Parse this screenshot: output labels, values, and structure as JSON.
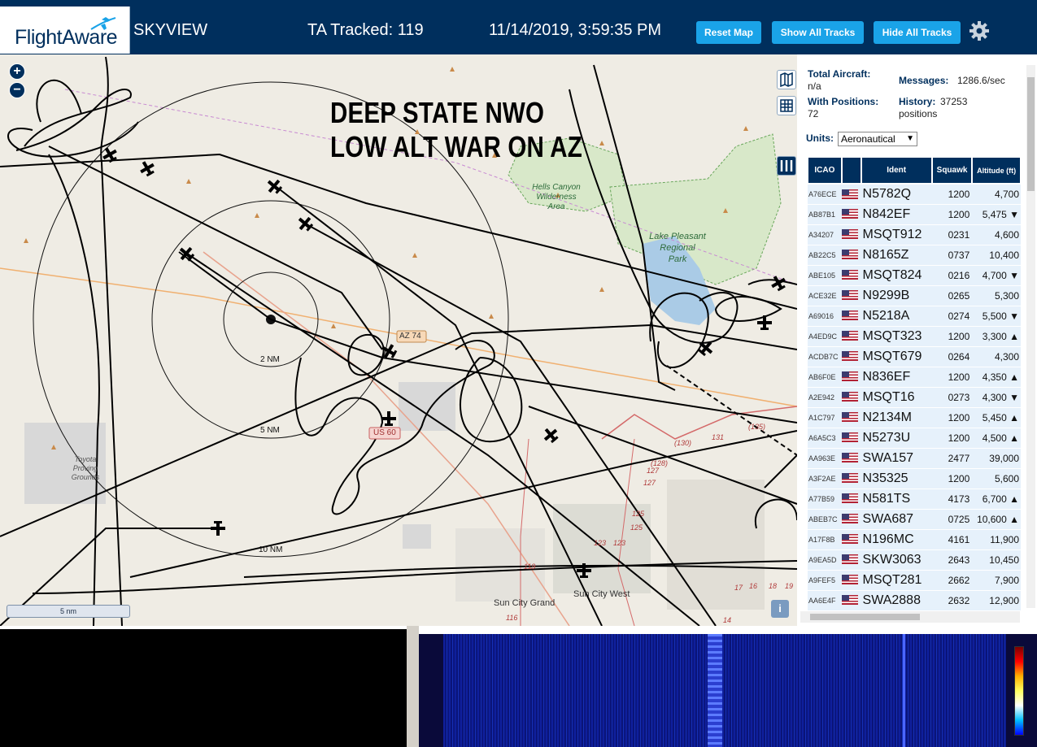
{
  "header": {
    "logo": "FlightAware",
    "app_name": "SKYVIEW",
    "ta_tracked": "TA Tracked: 119",
    "datetime": "11/14/2019, 3:59:35 PM",
    "buttons": {
      "reset_map": "Reset Map",
      "show_all": "Show All Tracks",
      "hide_all": "Hide All Tracks"
    }
  },
  "map": {
    "overlay_line1": "DEEP STATE NWO",
    "overlay_line2": "LOW ALT WAR ON AZ",
    "range_rings": [
      "2 NM",
      "5 NM",
      "10 NM"
    ],
    "road_labels": [
      "AZ 74",
      "US 60"
    ],
    "place_labels": {
      "hells_canyon": [
        "Hells Canyon",
        "Wilderness",
        "Area"
      ],
      "lake_pleasant": [
        "Lake Pleasant",
        "Regional",
        "Park"
      ],
      "toyota": [
        "Toyota",
        "Proving",
        "Grounds"
      ],
      "sun_city_grand": "Sun City Grand",
      "sun_city_west": "Sun City West"
    },
    "route_numbers": [
      "(130)",
      "131",
      "(128)",
      "127",
      "127",
      "125",
      "125",
      "123",
      "123",
      "119",
      "116",
      "14",
      "17",
      "16",
      "18",
      "19",
      "(135)"
    ],
    "scale": "5 nm",
    "zoom_in": "+",
    "zoom_out": "−",
    "info": "i"
  },
  "sidebar": {
    "total_aircraft_label": "Total Aircraft:",
    "total_aircraft_value": "n/a",
    "messages_label": "Messages:",
    "messages_value": "1286.6/sec",
    "positions_label": "With Positions:",
    "positions_value": "72",
    "history_label": "History:",
    "history_value": "37253",
    "history_unit": "positions",
    "units_label": "Units:",
    "units_value": "Aeronautical",
    "columns": [
      "ICAO",
      "Ident",
      "Squawk",
      "Altitude (ft)"
    ],
    "rows": [
      {
        "icao": "A76ECE",
        "ident": "N5782Q",
        "squawk": "1200",
        "alt": "4,700"
      },
      {
        "icao": "AB87B1",
        "ident": "N842EF",
        "squawk": "1200",
        "alt": "5,475 ▼"
      },
      {
        "icao": "A34207",
        "ident": "MSQT912",
        "squawk": "0231",
        "alt": "4,600"
      },
      {
        "icao": "AB22C5",
        "ident": "N8165Z",
        "squawk": "0737",
        "alt": "10,400"
      },
      {
        "icao": "ABE105",
        "ident": "MSQT824",
        "squawk": "0216",
        "alt": "4,700 ▼"
      },
      {
        "icao": "ACE32E",
        "ident": "N9299B",
        "squawk": "0265",
        "alt": "5,300"
      },
      {
        "icao": "A69016",
        "ident": "N5218A",
        "squawk": "0274",
        "alt": "5,500 ▼"
      },
      {
        "icao": "A4ED9C",
        "ident": "MSQT323",
        "squawk": "1200",
        "alt": "3,300 ▲"
      },
      {
        "icao": "ACDB7C",
        "ident": "MSQT679",
        "squawk": "0264",
        "alt": "4,300"
      },
      {
        "icao": "AB6F0E",
        "ident": "N836EF",
        "squawk": "1200",
        "alt": "4,350 ▲"
      },
      {
        "icao": "A2E942",
        "ident": "MSQT16",
        "squawk": "0273",
        "alt": "4,300 ▼"
      },
      {
        "icao": "A1C797",
        "ident": "N2134M",
        "squawk": "1200",
        "alt": "5,450 ▲"
      },
      {
        "icao": "A6A5C3",
        "ident": "N5273U",
        "squawk": "1200",
        "alt": "4,500 ▲"
      },
      {
        "icao": "AA963E",
        "ident": "SWA157",
        "squawk": "2477",
        "alt": "39,000"
      },
      {
        "icao": "A3F2AE",
        "ident": "N35325",
        "squawk": "1200",
        "alt": "5,600"
      },
      {
        "icao": "A77B59",
        "ident": "N581TS",
        "squawk": "4173",
        "alt": "6,700 ▲"
      },
      {
        "icao": "ABEB7C",
        "ident": "SWA687",
        "squawk": "0725",
        "alt": "10,600 ▲"
      },
      {
        "icao": "A17F8B",
        "ident": "N196MC",
        "squawk": "4161",
        "alt": "11,900"
      },
      {
        "icao": "A9EA5D",
        "ident": "SKW3063",
        "squawk": "2643",
        "alt": "10,450"
      },
      {
        "icao": "A9FEF5",
        "ident": "MSQT281",
        "squawk": "2662",
        "alt": "7,900"
      },
      {
        "icao": "AA6E4F",
        "ident": "SWA2888",
        "squawk": "2632",
        "alt": "12,900"
      }
    ]
  },
  "icons": [
    "flightaware-plane-icon",
    "gear-icon",
    "map-layers-icon",
    "grid-icon",
    "columns-icon",
    "us-flag-icon",
    "aircraft-icon"
  ],
  "colors": {
    "header": "#002f5d",
    "button": "#1aa3e8",
    "row": "#e6f1fb"
  }
}
